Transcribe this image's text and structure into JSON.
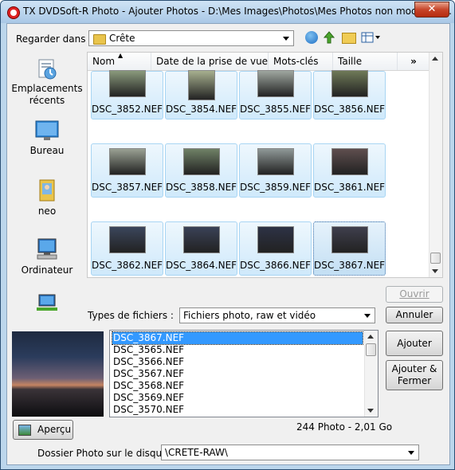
{
  "window": {
    "title": "TX DVDSoft-R Photo - Ajouter Photos - D:\\Mes Images\\Photos\\Mes Photos non modifiées...",
    "close_label": "✕"
  },
  "lookin": {
    "label": "Regarder dans :",
    "value": "Crête"
  },
  "places": [
    {
      "label": "Emplacements récents",
      "icon": "recent-places-icon"
    },
    {
      "label": "Bureau",
      "icon": "desktop-icon"
    },
    {
      "label": "neo",
      "icon": "user-folder-icon"
    },
    {
      "label": "Ordinateur",
      "icon": "computer-icon"
    },
    {
      "label": "",
      "icon": "network-icon"
    }
  ],
  "columns": [
    "Nom",
    "Date de la prise de vue",
    "Mots-clés",
    "Taille"
  ],
  "more_columns": "»",
  "files": [
    {
      "name": "DSC_3852.NEF",
      "thumb": "#8a9a7c"
    },
    {
      "name": "DSC_3854.NEF",
      "thumb": "#a7b08f"
    },
    {
      "name": "DSC_3855.NEF",
      "thumb": "#9fa7a0"
    },
    {
      "name": "DSC_3856.NEF",
      "thumb": "#6f7a58"
    },
    {
      "name": "DSC_3857.NEF",
      "thumb": "#9aa193"
    },
    {
      "name": "DSC_3858.NEF",
      "thumb": "#6f8166"
    },
    {
      "name": "DSC_3859.NEF",
      "thumb": "#8f9897"
    },
    {
      "name": "DSC_3861.NEF",
      "thumb": "#5e4e4e"
    },
    {
      "name": "DSC_3862.NEF",
      "thumb": "#3b465c"
    },
    {
      "name": "DSC_3864.NEF",
      "thumb": "#3a4257"
    },
    {
      "name": "DSC_3866.NEF",
      "thumb": "#2d3245"
    },
    {
      "name": "DSC_3867.NEF",
      "thumb": "#3f3f4d"
    }
  ],
  "selected_file": "DSC_3867.NEF",
  "buttons": {
    "open": "Ouvrir",
    "cancel": "Annuler",
    "add": "Ajouter",
    "add_close": "Ajouter & Fermer",
    "preview": "Aperçu"
  },
  "filetype": {
    "label": "Types de fichiers :",
    "value": "Fichiers photo, raw et vidéo"
  },
  "list": [
    "DSC_3867.NEF",
    "DSC_3565.NEF",
    "DSC_3566.NEF",
    "DSC_3567.NEF",
    "DSC_3568.NEF",
    "DSC_3569.NEF",
    "DSC_3570.NEF"
  ],
  "summary": "244 Photo - 2,01 Go",
  "disk_folder": {
    "label": "Dossier Photo sur le disque :",
    "value": "\\CRETE-RAW\\"
  },
  "colors": {
    "tile_border": "#a8d5f3",
    "selection": "#3399ff",
    "title_gradient_top": "#cfe3f5"
  }
}
